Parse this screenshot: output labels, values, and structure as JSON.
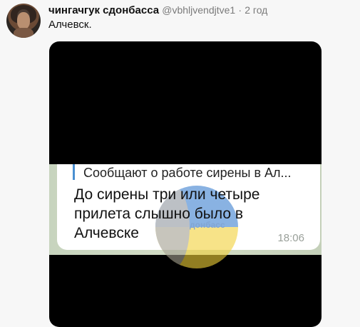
{
  "tweet": {
    "author": "чингачгук сдонбасса",
    "handle": "@vbhljvendjtve1",
    "separator": "·",
    "time": "2 год",
    "text": "Алчевск."
  },
  "media": {
    "telegram": {
      "quote": "Сообщают о работе сирены в Ал...",
      "lines": [
        "До сирены три или четыре",
        "прилета слышно было в",
        "Алчевске"
      ],
      "time": "18:06",
      "watermark_text": "донбасс"
    }
  }
}
